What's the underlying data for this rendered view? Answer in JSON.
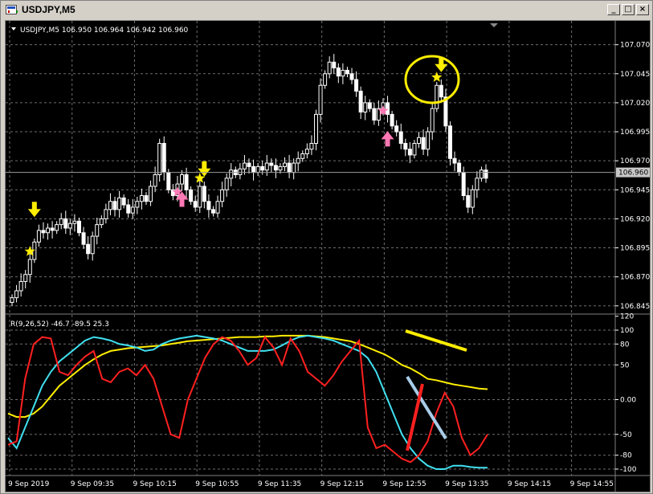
{
  "window": {
    "title": "USDJPY,M5",
    "minimize_label": "_",
    "maximize_label": "□",
    "close_label": "×"
  },
  "chart_info": {
    "header_text": "USDJPY,M5  106.950 106.964 106.942 106.960",
    "current_price_label": "106.960",
    "indicator_header": "R(9,26,52) -46.7 -89.5 25.3"
  },
  "colors": {
    "background": "#000000",
    "grid": "#6e6e6e",
    "candle": "#ffffff",
    "fast_line": "#ff2020",
    "mid_line": "#40e0f0",
    "slow_line": "#ffee00",
    "signal_buy": "#ff78b4",
    "signal_sell": "#ffee00"
  },
  "chart_data": [
    {
      "type": "candlestick",
      "symbol": "USDJPY",
      "timeframe": "M5",
      "ylim": [
        106.84,
        107.085
      ],
      "y_ticks": [
        "107.070",
        "107.045",
        "107.020",
        "106.995",
        "106.970",
        "106.945",
        "106.920",
        "106.895",
        "106.870",
        "106.845"
      ],
      "x_ticks": [
        "9 Sep 2019",
        "9 Sep 09:35",
        "9 Sep 10:15",
        "9 Sep 10:55",
        "9 Sep 11:35",
        "9 Sep 12:15",
        "9 Sep 12:55",
        "9 Sep 13:35",
        "9 Sep 14:15",
        "9 Sep 14:55"
      ],
      "current_price": 106.96,
      "closes": [
        106.852,
        106.858,
        106.866,
        106.872,
        106.885,
        106.9,
        106.91,
        106.908,
        106.912,
        106.91,
        106.915,
        106.92,
        106.912,
        106.916,
        106.918,
        106.908,
        106.898,
        106.89,
        106.905,
        106.915,
        106.92,
        106.928,
        106.935,
        106.928,
        106.938,
        106.932,
        106.925,
        106.93,
        106.935,
        106.94,
        106.935,
        106.948,
        106.958,
        106.985,
        106.96,
        106.945,
        106.94,
        106.95,
        106.958,
        106.945,
        106.935,
        106.93,
        106.948,
        106.935,
        106.928,
        106.925,
        106.935,
        106.945,
        106.955,
        106.962,
        106.958,
        106.963,
        106.968,
        106.965,
        106.96,
        106.965,
        106.962,
        106.968,
        106.966,
        106.962,
        106.965,
        106.968,
        106.96,
        106.968,
        106.972,
        106.976,
        106.98,
        106.985,
        107.01,
        107.035,
        107.045,
        107.055,
        107.05,
        107.043,
        107.048,
        107.045,
        107.04,
        107.03,
        107.012,
        107.02,
        107.015,
        107.005,
        107.015,
        107.02,
        107.01,
        107.0,
        106.995,
        106.985,
        106.98,
        106.975,
        106.985,
        106.99,
        106.98,
        106.995,
        107.015,
        107.035,
        107.025,
        107.0,
        106.972,
        106.968,
        106.96,
        106.94,
        106.93,
        106.945,
        106.955,
        106.962,
        106.955
      ],
      "signals": [
        {
          "kind": "star-sell",
          "index": 4
        },
        {
          "kind": "arrow-down",
          "index": 5
        },
        {
          "kind": "star-buy",
          "index": 37
        },
        {
          "kind": "arrow-up",
          "index": 38
        },
        {
          "kind": "star-sell",
          "index": 42
        },
        {
          "kind": "arrow-down",
          "index": 43
        },
        {
          "kind": "star-buy",
          "index": 83
        },
        {
          "kind": "arrow-up",
          "index": 84
        },
        {
          "kind": "star-sell",
          "index": 95
        },
        {
          "kind": "arrow-down",
          "index": 96
        }
      ]
    },
    {
      "type": "line",
      "title": "R(9,26,52)",
      "ylim": [
        -100,
        100
      ],
      "y_ticks": [
        "120",
        "100",
        "80",
        "50",
        "0.00",
        "-50",
        "-80",
        "-100"
      ],
      "series": [
        {
          "name": "fast",
          "color": "#ff2020",
          "values": [
            -65,
            -60,
            30,
            80,
            90,
            88,
            40,
            35,
            50,
            62,
            70,
            30,
            25,
            40,
            45,
            35,
            50,
            30,
            -10,
            -50,
            -55,
            0,
            30,
            60,
            80,
            90,
            85,
            70,
            50,
            60,
            90,
            75,
            50,
            88,
            70,
            40,
            30,
            20,
            35,
            55,
            70,
            85,
            -40,
            -70,
            -65,
            -75,
            -85,
            -90,
            -80,
            -60,
            -20,
            10,
            -10,
            -55,
            -80,
            -70,
            -50
          ]
        },
        {
          "name": "mid",
          "color": "#40e0f0",
          "values": [
            -55,
            -70,
            -40,
            -10,
            20,
            40,
            55,
            65,
            75,
            85,
            90,
            88,
            85,
            80,
            78,
            75,
            70,
            72,
            80,
            85,
            88,
            90,
            92,
            90,
            88,
            85,
            80,
            75,
            70,
            70,
            70,
            72,
            78,
            85,
            90,
            92,
            90,
            88,
            85,
            80,
            75,
            70,
            60,
            40,
            10,
            -20,
            -50,
            -70,
            -85,
            -95,
            -100,
            -100,
            -95,
            -95,
            -97,
            -98,
            -98
          ]
        },
        {
          "name": "slow",
          "color": "#ffee00",
          "values": [
            -20,
            -25,
            -25,
            -20,
            -10,
            5,
            20,
            30,
            40,
            50,
            58,
            65,
            70,
            72,
            74,
            75,
            76,
            77,
            78,
            80,
            82,
            84,
            85,
            86,
            87,
            88,
            89,
            90,
            90,
            90,
            91,
            91,
            92,
            92,
            92,
            92,
            91,
            90,
            88,
            86,
            84,
            80,
            75,
            70,
            65,
            58,
            50,
            45,
            38,
            30,
            28,
            25,
            22,
            20,
            18,
            16,
            15
          ]
        }
      ]
    }
  ],
  "annotations": [
    {
      "kind": "circle",
      "color": "#ffee00"
    },
    {
      "kind": "stroke",
      "color": "#ffee00"
    },
    {
      "kind": "stroke",
      "color": "#a8cce8"
    },
    {
      "kind": "stroke",
      "color": "#ff2020"
    }
  ]
}
